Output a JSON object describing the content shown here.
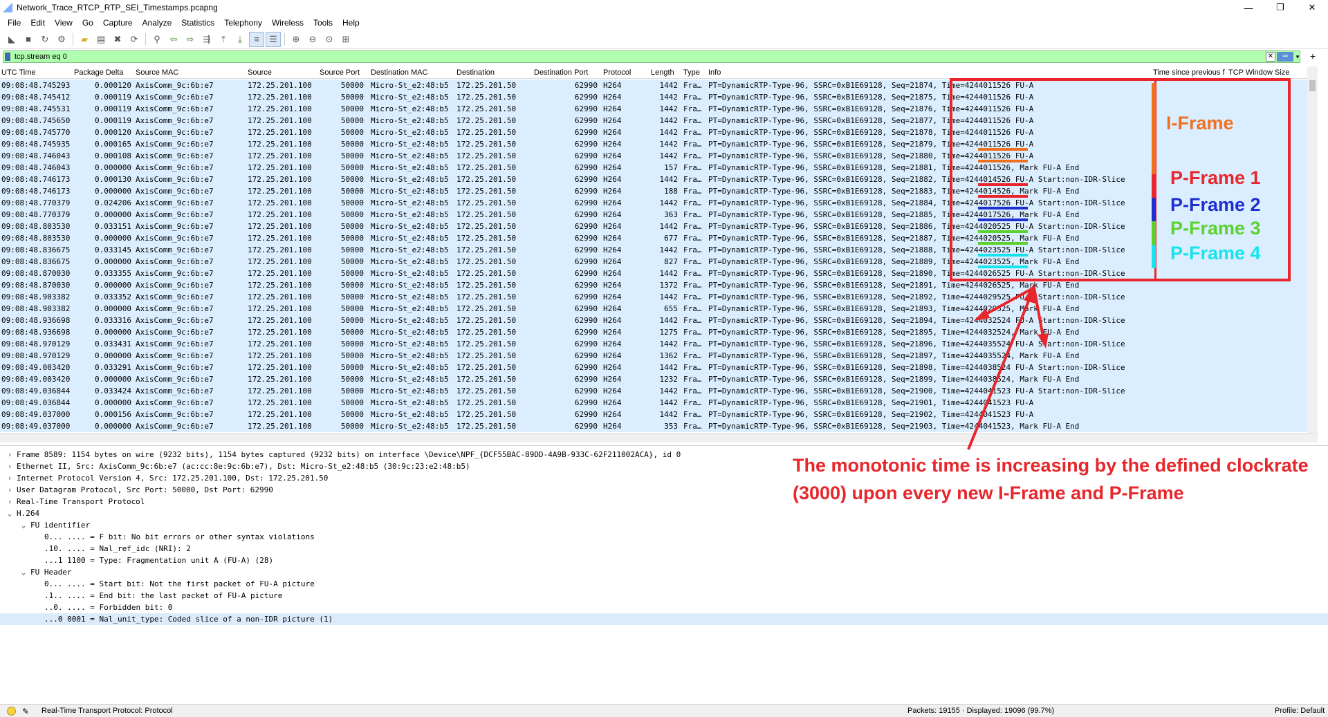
{
  "window": {
    "title": "Network_Trace_RTCP_RTP_SEI_Timestamps.pcapng",
    "controls": [
      "—",
      "❐",
      "✕"
    ]
  },
  "menu": [
    "File",
    "Edit",
    "View",
    "Go",
    "Capture",
    "Analyze",
    "Statistics",
    "Telephony",
    "Wireless",
    "Tools",
    "Help"
  ],
  "toolbar": {
    "icons": [
      "shark-fin-start-icon",
      "stop-square-icon",
      "restart-icon",
      "options-gear-icon",
      "open-folder-icon",
      "save-icon",
      "close-file-icon",
      "reload-icon",
      "find-icon",
      "back-arrow-icon",
      "forward-arrow-icon",
      "go-to-packet-icon",
      "first-packet-icon",
      "last-packet-icon",
      "autoscroll-icon",
      "colorize-icon",
      "zoom-in-icon",
      "zoom-out-icon",
      "zoom-normal-icon",
      "resize-columns-icon"
    ]
  },
  "filter": {
    "value": "tcp.stream eq 0"
  },
  "packet_list": {
    "columns": [
      "UTC Time",
      "Package Delta",
      "Source MAC",
      "Source",
      "Source Port",
      "Destination MAC",
      "Destination",
      "Destination Port",
      "Protocol",
      "Length",
      "Type",
      "Info",
      "Time since previous f",
      "TCP Window Size"
    ],
    "rows": [
      [
        "09:08:48.745293",
        "0.000120",
        "AxisComm_9c:6b:e7",
        "172.25.201.100",
        "50000",
        "Micro-St_e2:48:b5",
        "172.25.201.50",
        "62990",
        "H264",
        "1442",
        "Fra…",
        "PT=DynamicRTP-Type-96, SSRC=0xB1E69128, Seq=21874, Time=4244011526 FU-A"
      ],
      [
        "09:08:48.745412",
        "0.000119",
        "AxisComm_9c:6b:e7",
        "172.25.201.100",
        "50000",
        "Micro-St_e2:48:b5",
        "172.25.201.50",
        "62990",
        "H264",
        "1442",
        "Fra…",
        "PT=DynamicRTP-Type-96, SSRC=0xB1E69128, Seq=21875, Time=4244011526 FU-A"
      ],
      [
        "09:08:48.745531",
        "0.000119",
        "AxisComm_9c:6b:e7",
        "172.25.201.100",
        "50000",
        "Micro-St_e2:48:b5",
        "172.25.201.50",
        "62990",
        "H264",
        "1442",
        "Fra…",
        "PT=DynamicRTP-Type-96, SSRC=0xB1E69128, Seq=21876, Time=4244011526 FU-A"
      ],
      [
        "09:08:48.745650",
        "0.000119",
        "AxisComm_9c:6b:e7",
        "172.25.201.100",
        "50000",
        "Micro-St_e2:48:b5",
        "172.25.201.50",
        "62990",
        "H264",
        "1442",
        "Fra…",
        "PT=DynamicRTP-Type-96, SSRC=0xB1E69128, Seq=21877, Time=4244011526 FU-A"
      ],
      [
        "09:08:48.745770",
        "0.000120",
        "AxisComm_9c:6b:e7",
        "172.25.201.100",
        "50000",
        "Micro-St_e2:48:b5",
        "172.25.201.50",
        "62990",
        "H264",
        "1442",
        "Fra…",
        "PT=DynamicRTP-Type-96, SSRC=0xB1E69128, Seq=21878, Time=4244011526 FU-A"
      ],
      [
        "09:08:48.745935",
        "0.000165",
        "AxisComm_9c:6b:e7",
        "172.25.201.100",
        "50000",
        "Micro-St_e2:48:b5",
        "172.25.201.50",
        "62990",
        "H264",
        "1442",
        "Fra…",
        "PT=DynamicRTP-Type-96, SSRC=0xB1E69128, Seq=21879, Time=4244011526 FU-A"
      ],
      [
        "09:08:48.746043",
        "0.000108",
        "AxisComm_9c:6b:e7",
        "172.25.201.100",
        "50000",
        "Micro-St_e2:48:b5",
        "172.25.201.50",
        "62990",
        "H264",
        "1442",
        "Fra…",
        "PT=DynamicRTP-Type-96, SSRC=0xB1E69128, Seq=21880, Time=4244011526 FU-A"
      ],
      [
        "09:08:48.746043",
        "0.000000",
        "AxisComm_9c:6b:e7",
        "172.25.201.100",
        "50000",
        "Micro-St_e2:48:b5",
        "172.25.201.50",
        "62990",
        "H264",
        "157",
        "Fra…",
        "PT=DynamicRTP-Type-96, SSRC=0xB1E69128, Seq=21881, Time=4244011526, Mark FU-A End"
      ],
      [
        "09:08:48.746173",
        "0.000130",
        "AxisComm_9c:6b:e7",
        "172.25.201.100",
        "50000",
        "Micro-St_e2:48:b5",
        "172.25.201.50",
        "62990",
        "H264",
        "1442",
        "Fra…",
        "PT=DynamicRTP-Type-96, SSRC=0xB1E69128, Seq=21882, Time=4244014526 FU-A Start:non-IDR-Slice"
      ],
      [
        "09:08:48.746173",
        "0.000000",
        "AxisComm_9c:6b:e7",
        "172.25.201.100",
        "50000",
        "Micro-St_e2:48:b5",
        "172.25.201.50",
        "62990",
        "H264",
        "188",
        "Fra…",
        "PT=DynamicRTP-Type-96, SSRC=0xB1E69128, Seq=21883, Time=4244014526, Mark FU-A End"
      ],
      [
        "09:08:48.770379",
        "0.024206",
        "AxisComm_9c:6b:e7",
        "172.25.201.100",
        "50000",
        "Micro-St_e2:48:b5",
        "172.25.201.50",
        "62990",
        "H264",
        "1442",
        "Fra…",
        "PT=DynamicRTP-Type-96, SSRC=0xB1E69128, Seq=21884, Time=4244017526 FU-A Start:non-IDR-Slice"
      ],
      [
        "09:08:48.770379",
        "0.000000",
        "AxisComm_9c:6b:e7",
        "172.25.201.100",
        "50000",
        "Micro-St_e2:48:b5",
        "172.25.201.50",
        "62990",
        "H264",
        "363",
        "Fra…",
        "PT=DynamicRTP-Type-96, SSRC=0xB1E69128, Seq=21885, Time=4244017526, Mark FU-A End"
      ],
      [
        "09:08:48.803530",
        "0.033151",
        "AxisComm_9c:6b:e7",
        "172.25.201.100",
        "50000",
        "Micro-St_e2:48:b5",
        "172.25.201.50",
        "62990",
        "H264",
        "1442",
        "Fra…",
        "PT=DynamicRTP-Type-96, SSRC=0xB1E69128, Seq=21886, Time=4244020525 FU-A Start:non-IDR-Slice"
      ],
      [
        "09:08:48.803530",
        "0.000000",
        "AxisComm_9c:6b:e7",
        "172.25.201.100",
        "50000",
        "Micro-St_e2:48:b5",
        "172.25.201.50",
        "62990",
        "H264",
        "677",
        "Fra…",
        "PT=DynamicRTP-Type-96, SSRC=0xB1E69128, Seq=21887, Time=4244020525, Mark FU-A End"
      ],
      [
        "09:08:48.836675",
        "0.033145",
        "AxisComm_9c:6b:e7",
        "172.25.201.100",
        "50000",
        "Micro-St_e2:48:b5",
        "172.25.201.50",
        "62990",
        "H264",
        "1442",
        "Fra…",
        "PT=DynamicRTP-Type-96, SSRC=0xB1E69128, Seq=21888, Time=4244023525 FU-A Start:non-IDR-Slice"
      ],
      [
        "09:08:48.836675",
        "0.000000",
        "AxisComm_9c:6b:e7",
        "172.25.201.100",
        "50000",
        "Micro-St_e2:48:b5",
        "172.25.201.50",
        "62990",
        "H264",
        "827",
        "Fra…",
        "PT=DynamicRTP-Type-96, SSRC=0xB1E69128, Seq=21889, Time=4244023525, Mark FU-A End"
      ],
      [
        "09:08:48.870030",
        "0.033355",
        "AxisComm_9c:6b:e7",
        "172.25.201.100",
        "50000",
        "Micro-St_e2:48:b5",
        "172.25.201.50",
        "62990",
        "H264",
        "1442",
        "Fra…",
        "PT=DynamicRTP-Type-96, SSRC=0xB1E69128, Seq=21890, Time=4244026525 FU-A Start:non-IDR-Slice"
      ],
      [
        "09:08:48.870030",
        "0.000000",
        "AxisComm_9c:6b:e7",
        "172.25.201.100",
        "50000",
        "Micro-St_e2:48:b5",
        "172.25.201.50",
        "62990",
        "H264",
        "1372",
        "Fra…",
        "PT=DynamicRTP-Type-96, SSRC=0xB1E69128, Seq=21891, Time=4244026525, Mark FU-A End"
      ],
      [
        "09:08:48.903382",
        "0.033352",
        "AxisComm_9c:6b:e7",
        "172.25.201.100",
        "50000",
        "Micro-St_e2:48:b5",
        "172.25.201.50",
        "62990",
        "H264",
        "1442",
        "Fra…",
        "PT=DynamicRTP-Type-96, SSRC=0xB1E69128, Seq=21892, Time=4244029525 FU-A Start:non-IDR-Slice"
      ],
      [
        "09:08:48.903382",
        "0.000000",
        "AxisComm_9c:6b:e7",
        "172.25.201.100",
        "50000",
        "Micro-St_e2:48:b5",
        "172.25.201.50",
        "62990",
        "H264",
        "655",
        "Fra…",
        "PT=DynamicRTP-Type-96, SSRC=0xB1E69128, Seq=21893, Time=4244029525, Mark FU-A End"
      ],
      [
        "09:08:48.936698",
        "0.033316",
        "AxisComm_9c:6b:e7",
        "172.25.201.100",
        "50000",
        "Micro-St_e2:48:b5",
        "172.25.201.50",
        "62990",
        "H264",
        "1442",
        "Fra…",
        "PT=DynamicRTP-Type-96, SSRC=0xB1E69128, Seq=21894, Time=4244032524 FU-A Start:non-IDR-Slice"
      ],
      [
        "09:08:48.936698",
        "0.000000",
        "AxisComm_9c:6b:e7",
        "172.25.201.100",
        "50000",
        "Micro-St_e2:48:b5",
        "172.25.201.50",
        "62990",
        "H264",
        "1275",
        "Fra…",
        "PT=DynamicRTP-Type-96, SSRC=0xB1E69128, Seq=21895, Time=4244032524, Mark FU-A End"
      ],
      [
        "09:08:48.970129",
        "0.033431",
        "AxisComm_9c:6b:e7",
        "172.25.201.100",
        "50000",
        "Micro-St_e2:48:b5",
        "172.25.201.50",
        "62990",
        "H264",
        "1442",
        "Fra…",
        "PT=DynamicRTP-Type-96, SSRC=0xB1E69128, Seq=21896, Time=4244035524 FU-A Start:non-IDR-Slice"
      ],
      [
        "09:08:48.970129",
        "0.000000",
        "AxisComm_9c:6b:e7",
        "172.25.201.100",
        "50000",
        "Micro-St_e2:48:b5",
        "172.25.201.50",
        "62990",
        "H264",
        "1362",
        "Fra…",
        "PT=DynamicRTP-Type-96, SSRC=0xB1E69128, Seq=21897, Time=4244035524, Mark FU-A End"
      ],
      [
        "09:08:49.003420",
        "0.033291",
        "AxisComm_9c:6b:e7",
        "172.25.201.100",
        "50000",
        "Micro-St_e2:48:b5",
        "172.25.201.50",
        "62990",
        "H264",
        "1442",
        "Fra…",
        "PT=DynamicRTP-Type-96, SSRC=0xB1E69128, Seq=21898, Time=4244038524 FU-A Start:non-IDR-Slice"
      ],
      [
        "09:08:49.003420",
        "0.000000",
        "AxisComm_9c:6b:e7",
        "172.25.201.100",
        "50000",
        "Micro-St_e2:48:b5",
        "172.25.201.50",
        "62990",
        "H264",
        "1232",
        "Fra…",
        "PT=DynamicRTP-Type-96, SSRC=0xB1E69128, Seq=21899, Time=4244038524, Mark FU-A End"
      ],
      [
        "09:08:49.036844",
        "0.033424",
        "AxisComm_9c:6b:e7",
        "172.25.201.100",
        "50000",
        "Micro-St_e2:48:b5",
        "172.25.201.50",
        "62990",
        "H264",
        "1442",
        "Fra…",
        "PT=DynamicRTP-Type-96, SSRC=0xB1E69128, Seq=21900, Time=4244041523 FU-A Start:non-IDR-Slice"
      ],
      [
        "09:08:49.036844",
        "0.000000",
        "AxisComm_9c:6b:e7",
        "172.25.201.100",
        "50000",
        "Micro-St_e2:48:b5",
        "172.25.201.50",
        "62990",
        "H264",
        "1442",
        "Fra…",
        "PT=DynamicRTP-Type-96, SSRC=0xB1E69128, Seq=21901, Time=4244041523 FU-A"
      ],
      [
        "09:08:49.037000",
        "0.000156",
        "AxisComm_9c:6b:e7",
        "172.25.201.100",
        "50000",
        "Micro-St_e2:48:b5",
        "172.25.201.50",
        "62990",
        "H264",
        "1442",
        "Fra…",
        "PT=DynamicRTP-Type-96, SSRC=0xB1E69128, Seq=21902, Time=4244041523 FU-A"
      ],
      [
        "09:08:49.037000",
        "0.000000",
        "AxisComm_9c:6b:e7",
        "172.25.201.100",
        "50000",
        "Micro-St_e2:48:b5",
        "172.25.201.50",
        "62990",
        "H264",
        "353",
        "Fra…",
        "PT=DynamicRTP-Type-96, SSRC=0xB1E69128, Seq=21903, Time=4244041523, Mark FU-A End"
      ]
    ]
  },
  "details": [
    {
      "indent": 0,
      "arrow": "›",
      "text": "Frame 8589: 1154 bytes on wire (9232 bits), 1154 bytes captured (9232 bits) on interface \\Device\\NPF_{DCF55BAC-89DD-4A9B-933C-62F211002ACA}, id 0"
    },
    {
      "indent": 0,
      "arrow": "›",
      "text": "Ethernet II, Src: AxisComm_9c:6b:e7 (ac:cc:8e:9c:6b:e7), Dst: Micro-St_e2:48:b5 (30:9c:23:e2:48:b5)"
    },
    {
      "indent": 0,
      "arrow": "›",
      "text": "Internet Protocol Version 4, Src: 172.25.201.100, Dst: 172.25.201.50"
    },
    {
      "indent": 0,
      "arrow": "›",
      "text": "User Datagram Protocol, Src Port: 50000, Dst Port: 62990"
    },
    {
      "indent": 0,
      "arrow": "›",
      "text": "Real-Time Transport Protocol"
    },
    {
      "indent": 0,
      "arrow": "⌄",
      "text": "H.264"
    },
    {
      "indent": 1,
      "arrow": "⌄",
      "text": "FU identifier"
    },
    {
      "indent": 2,
      "arrow": "",
      "text": "0... .... = F bit: No bit errors or other syntax violations"
    },
    {
      "indent": 2,
      "arrow": "",
      "text": ".10. .... = Nal_ref_idc (NRI): 2"
    },
    {
      "indent": 2,
      "arrow": "",
      "text": "...1 1100 = Type: Fragmentation unit A (FU-A) (28)"
    },
    {
      "indent": 1,
      "arrow": "⌄",
      "text": "FU Header"
    },
    {
      "indent": 2,
      "arrow": "",
      "text": "0... .... = Start bit: Not the first packet of FU-A picture"
    },
    {
      "indent": 2,
      "arrow": "",
      "text": ".1.. .... = End bit: the last packet of FU-A picture"
    },
    {
      "indent": 2,
      "arrow": "",
      "text": "..0. .... = Forbidden bit: 0"
    },
    {
      "indent": 2,
      "arrow": "",
      "text": "...0 0001 = Nal_unit_type: Coded slice of a non-IDR picture (1)",
      "selected": true
    }
  ],
  "status": {
    "protocol": "Real-Time Transport Protocol: Protocol",
    "packets": "Packets: 19155 · Displayed: 19096 (99.7%)",
    "profile": "Profile: Default"
  },
  "annotations": {
    "labels": [
      {
        "text": "I-Frame",
        "color": "#f07020"
      },
      {
        "text": "P-Frame 1",
        "color": "#e8262b"
      },
      {
        "text": "P-Frame 2",
        "color": "#1f2fd0"
      },
      {
        "text": "P-Frame 3",
        "color": "#5bd22d"
      },
      {
        "text": "P-Frame 4",
        "color": "#17e3ee"
      }
    ],
    "note_line1": "The monotonic time is increasing by the defined clockrate",
    "note_line2": "(3000) upon every new I-Frame and P-Frame"
  },
  "colors": {
    "row_bg": "#daeeff",
    "filter_bg": "#afffaf",
    "annotation_red": "#e8262b"
  }
}
